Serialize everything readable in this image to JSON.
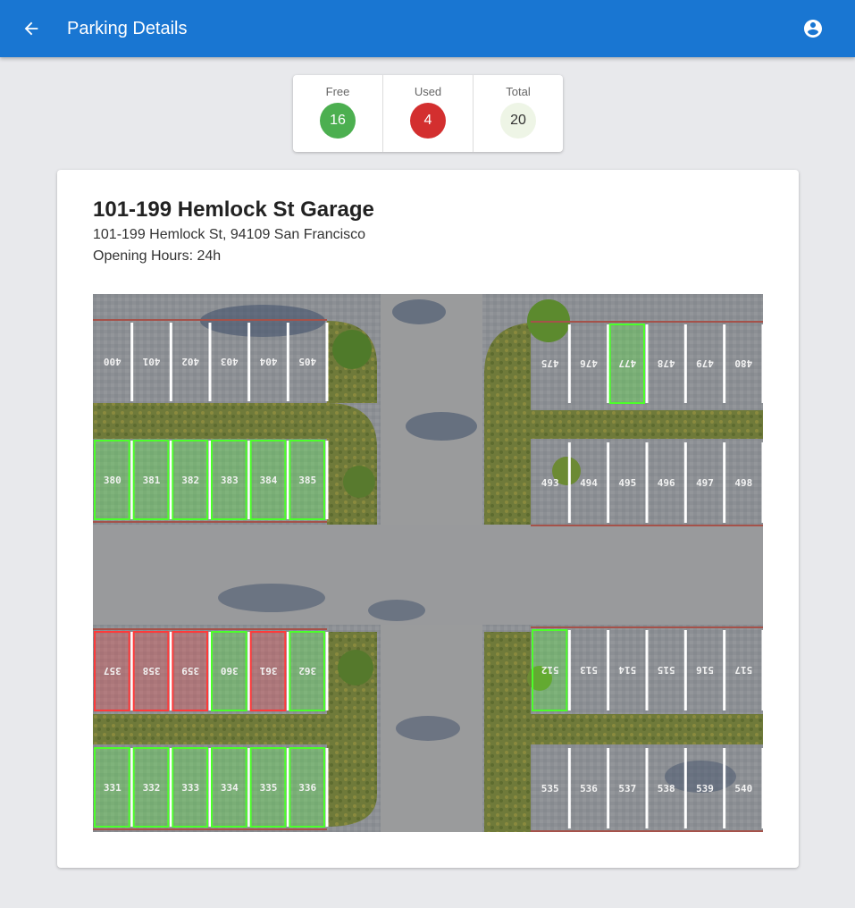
{
  "appbar": {
    "title": "Parking Details",
    "back_icon": "arrow-left-icon",
    "account_icon": "account-circle-icon",
    "color": "#1976d2"
  },
  "stats": [
    {
      "label": "Free",
      "value": "16",
      "color": "#4caf50",
      "text_color": "#ffffff"
    },
    {
      "label": "Used",
      "value": "4",
      "color": "#d32f2f",
      "text_color": "#ffffff"
    },
    {
      "label": "Total",
      "value": "20",
      "color": "#eef5e6",
      "text_color": "#333333"
    }
  ],
  "garage": {
    "name": "101-199 Hemlock St Garage",
    "address": "101-199 Hemlock St, 94109 San Francisco",
    "hours": "Opening Hours: 24h"
  },
  "map": {
    "free_color": "#4cff2a",
    "used_color": "#ff3a3a",
    "rows": [
      {
        "spots": [
          "400",
          "401",
          "402",
          "403",
          "404",
          "405"
        ],
        "flipped": true
      },
      {
        "spots": [
          "380",
          "381",
          "382",
          "383",
          "384",
          "385"
        ],
        "status": [
          "free",
          "free",
          "free",
          "free",
          "free",
          "free"
        ]
      },
      {
        "spots": [
          "357",
          "358",
          "359",
          "360",
          "361",
          "362"
        ],
        "flipped": true,
        "status": [
          "used",
          "used",
          "used",
          "free",
          "used",
          "free"
        ]
      },
      {
        "spots": [
          "331",
          "332",
          "333",
          "334",
          "335",
          "336"
        ],
        "status": [
          "free",
          "free",
          "free",
          "free",
          "free",
          "free"
        ]
      },
      {
        "spots": [
          "475",
          "476",
          "477",
          "478",
          "479",
          "480"
        ],
        "flipped": true,
        "status": [
          "",
          "",
          "free",
          "",
          "",
          ""
        ]
      },
      {
        "spots": [
          "493",
          "494",
          "495",
          "496",
          "497",
          "498"
        ]
      },
      {
        "spots": [
          "512",
          "513",
          "514",
          "515",
          "516",
          "517"
        ],
        "flipped": true,
        "status": [
          "free",
          "",
          "",
          "",
          "",
          ""
        ]
      },
      {
        "spots": [
          "535",
          "536",
          "537",
          "538",
          "539",
          "540"
        ]
      }
    ]
  }
}
